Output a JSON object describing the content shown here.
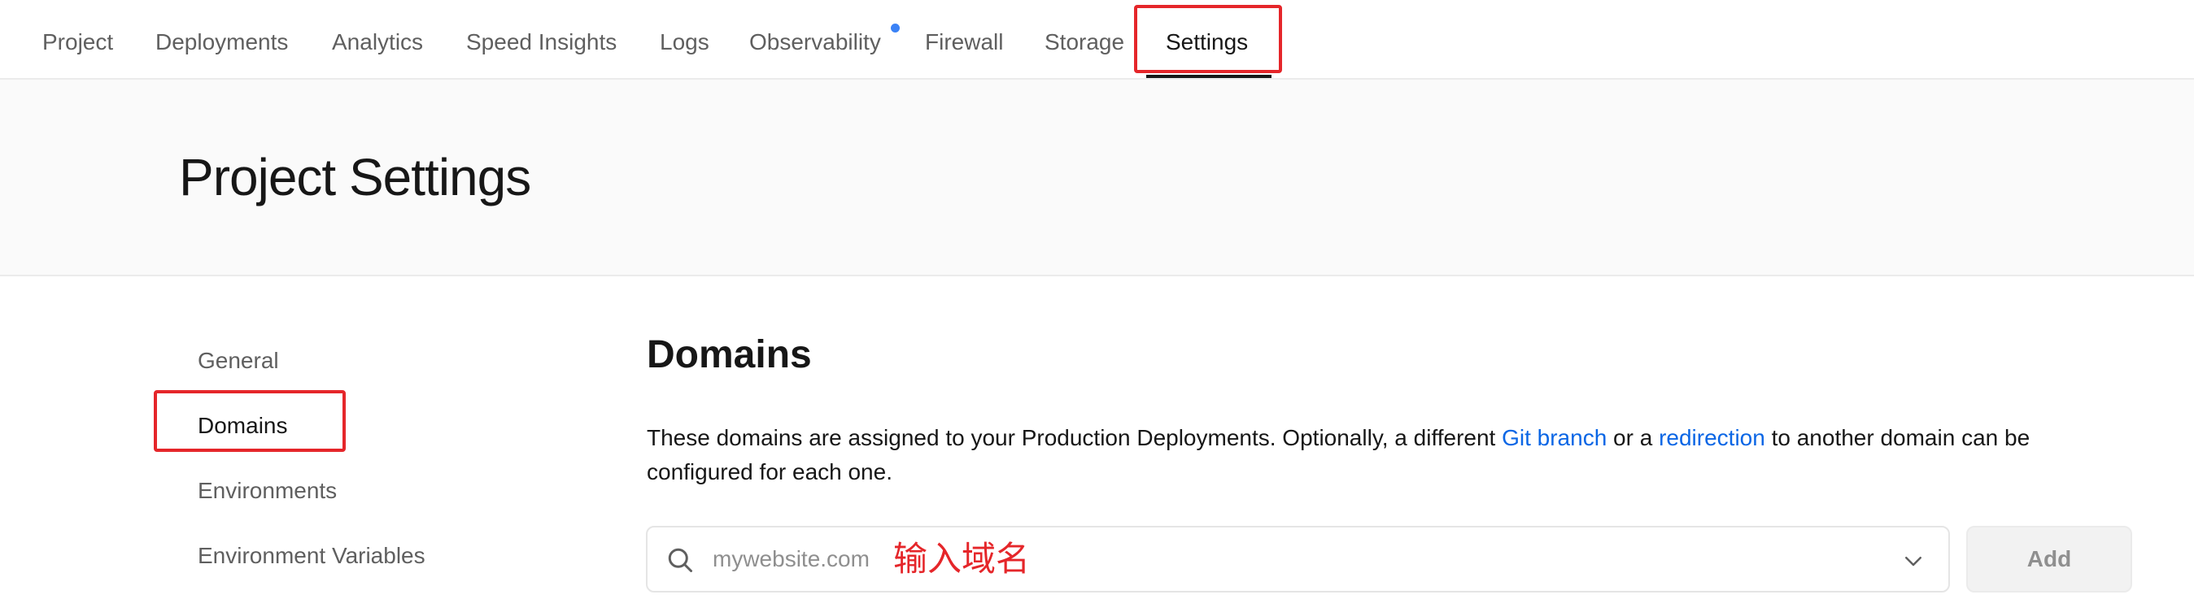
{
  "nav": {
    "tabs": [
      {
        "label": "Project"
      },
      {
        "label": "Deployments"
      },
      {
        "label": "Analytics"
      },
      {
        "label": "Speed Insights"
      },
      {
        "label": "Logs"
      },
      {
        "label": "Observability"
      },
      {
        "label": "Firewall"
      },
      {
        "label": "Storage"
      },
      {
        "label": "Settings"
      }
    ],
    "active_tab": "Settings"
  },
  "header": {
    "title": "Project Settings"
  },
  "sidebar": {
    "items": [
      {
        "label": "General"
      },
      {
        "label": "Domains"
      },
      {
        "label": "Environments"
      },
      {
        "label": "Environment Variables"
      }
    ],
    "active_item": "Domains"
  },
  "domains": {
    "title": "Domains",
    "description": {
      "part1": "These domains are assigned to your Production Deployments. Optionally, a different ",
      "link1": "Git branch",
      "part2": " or a ",
      "link2": "redirection",
      "part3": " to another domain can be configured for each one."
    },
    "input": {
      "value": "",
      "placeholder": "mywebsite.com"
    },
    "annotation": "输入域名",
    "add_label": "Add"
  },
  "icons": {
    "search": "search-icon",
    "chevron": "chevron-down-icon"
  },
  "colors": {
    "accent_link": "#0a66e5",
    "highlight": "#e5262a",
    "notification_dot": "#3b82f6"
  }
}
